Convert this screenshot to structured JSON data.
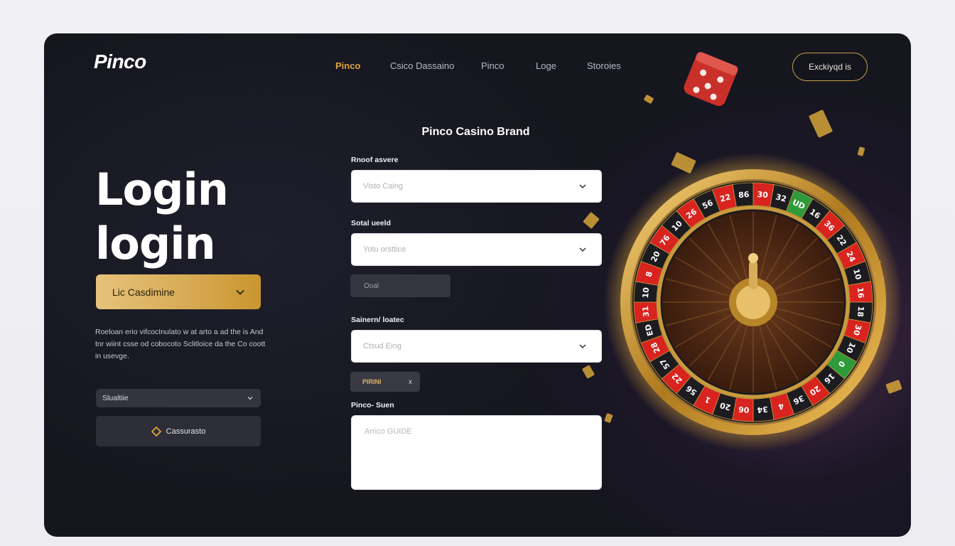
{
  "brand": {
    "logo_text": "Pinco"
  },
  "nav": {
    "items": [
      {
        "label": "Pinco",
        "active": true
      },
      {
        "label": "Csico Dassaino",
        "active": false
      },
      {
        "label": "Pinco",
        "active": false
      },
      {
        "label": "Loge",
        "active": false
      },
      {
        "label": "Storoies",
        "active": false
      }
    ],
    "cta_label": "Exckiyqd is"
  },
  "hero": {
    "title_line1": "Login",
    "title_line2": "login",
    "gold_select_value": "Lic Casdimine",
    "description": "Roeloan erio vifcocInulato w at arto a ad the is And tnr wiint csse od cobocoto Sclitloice da the Co coott in usevge.",
    "dark_select_value": "Slualtiie",
    "dark_button_label": "Cassurasto"
  },
  "form": {
    "title": "Pinco Casino Brand",
    "field1": {
      "label": "Rnoof asvere",
      "placeholder": "Visto Caing"
    },
    "field2": {
      "label": "Sotal ueeld",
      "placeholder": "Yotu orsttice"
    },
    "small_button_label": "Ooal",
    "field3": {
      "label": "Sainern/ loatec",
      "placeholder": "Ctsud Eing"
    },
    "tiny_select": {
      "value": "PIRINI",
      "icon": "x"
    },
    "textarea": {
      "label": "Pinco- Suen",
      "placeholder": "Arrico GUIDE"
    }
  },
  "roulette_numbers": [
    "30",
    "32",
    "UD",
    "16",
    "36",
    "22",
    "24",
    "10",
    "16",
    "18",
    "30",
    "10",
    "0",
    "16",
    "20",
    "36",
    "4",
    "34",
    "06",
    "20",
    "1",
    "56",
    "22",
    "57",
    "28",
    "ED",
    "31",
    "10",
    "8",
    "20",
    "76",
    "10",
    "26",
    "56",
    "22",
    "86"
  ],
  "colors": {
    "accent_gold": "#d9ad58",
    "background_dark": "#16161f",
    "page_bg": "#efeff3"
  },
  "icons": {
    "gold_select": "chevron-down-icon",
    "dark_select": "chevron-down-icon",
    "dark_button": "diamond-icon"
  }
}
